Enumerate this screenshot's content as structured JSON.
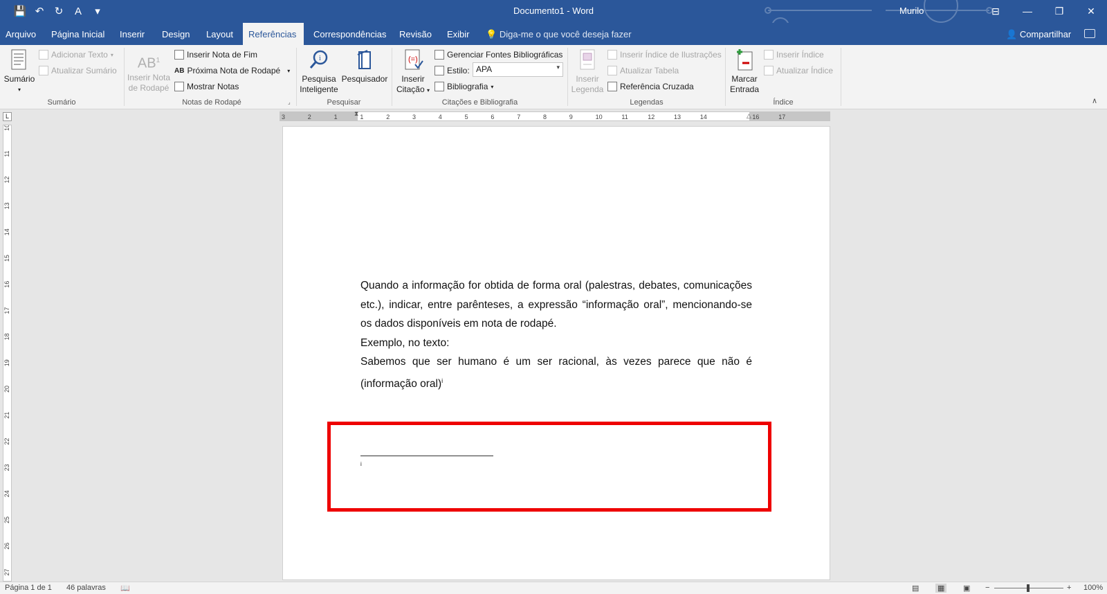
{
  "titlebar": {
    "title": "Documento1 - Word",
    "user": "Murilo",
    "qat": [
      {
        "icon": "save-icon",
        "glyph": "💾"
      },
      {
        "icon": "undo-icon",
        "glyph": "↶"
      },
      {
        "icon": "redo-icon",
        "glyph": "↻"
      },
      {
        "icon": "spelling-icon",
        "glyph": "A"
      },
      {
        "icon": "customize-qat-icon",
        "glyph": "▾"
      }
    ],
    "window_buttons": [
      {
        "icon": "ribbon-display-icon",
        "glyph": "⊟"
      },
      {
        "icon": "minimize-icon",
        "glyph": "—"
      },
      {
        "icon": "restore-icon",
        "glyph": "❐"
      },
      {
        "icon": "close-icon",
        "glyph": "✕"
      }
    ]
  },
  "tabs": [
    "Arquivo",
    "Página Inicial",
    "Inserir",
    "Design",
    "Layout",
    "Referências",
    "Correspondências",
    "Revisão",
    "Exibir"
  ],
  "active_tab": "Referências",
  "tell_me": "Diga-me o que você deseja fazer",
  "share": "Compartilhar",
  "ribbon": {
    "sumario": {
      "big_button_line1": "Sumário",
      "adicionar_texto": "Adicionar Texto",
      "atualizar_sumario": "Atualizar Sumário",
      "group": "Sumário"
    },
    "notas": {
      "inserir_nota_line1": "Inserir Nota",
      "inserir_nota_line2": "de Rodapé",
      "inserir_nota_fim": "Inserir Nota de Fim",
      "proxima_nota": "Próxima Nota de Rodapé",
      "mostrar_notas": "Mostrar Notas",
      "group": "Notas de Rodapé"
    },
    "pesquisar": {
      "pesquisa_line1": "Pesquisa",
      "pesquisa_line2": "Inteligente",
      "pesquisador": "Pesquisador",
      "group": "Pesquisar"
    },
    "citacoes": {
      "inserir_line1": "Inserir",
      "inserir_line2": "Citação",
      "gerenciar": "Gerenciar Fontes Bibliográficas",
      "estilo_label": "Estilo:",
      "estilo_value": "APA",
      "bibliografia": "Bibliografia",
      "group": "Citações e Bibliografia"
    },
    "legendas": {
      "inserir_line1": "Inserir",
      "inserir_line2": "Legenda",
      "inserir_indice_ilustracoes": "Inserir Índice de Ilustrações",
      "atualizar_tabela": "Atualizar Tabela",
      "referencia_cruzada": "Referência Cruzada",
      "group": "Legendas"
    },
    "indice": {
      "marcar_line1": "Marcar",
      "marcar_line2": "Entrada",
      "inserir_indice": "Inserir Índice",
      "atualizar_indice": "Atualizar Índice",
      "group": "Índice"
    }
  },
  "ruler": {
    "h_labels": [
      "3",
      "2",
      "1",
      "1",
      "2",
      "3",
      "4",
      "5",
      "6",
      "7",
      "8",
      "9",
      "10",
      "11",
      "12",
      "13",
      "14",
      "16",
      "17"
    ],
    "v_labels": [
      "10",
      "11",
      "12",
      "13",
      "14",
      "15",
      "16",
      "17",
      "18",
      "19",
      "20",
      "21",
      "22",
      "23",
      "24",
      "25",
      "26",
      "27"
    ],
    "tab_selector": "L"
  },
  "document": {
    "paragraph1": "Quando a informação for obtida de forma oral (palestras, debates, comunicações etc.), indicar, entre parênteses, a expressão “informação oral”, mencionando-se os dados disponíveis em nota de rodapé.",
    "paragraph2": "Exemplo, no texto:",
    "paragraph3": "Sabemos que ser humano é um ser racional, às vezes parece que não é (informação oral)",
    "footnote_mark": "i",
    "footnote_ref": "i",
    "highlight_color": "#ee0000"
  },
  "statusbar": {
    "page": "Página 1 de 1",
    "words": "46 palavras",
    "zoom": "100%"
  },
  "colors": {
    "word_blue": "#2b579a",
    "ribbon_bg": "#f3f3f3"
  }
}
